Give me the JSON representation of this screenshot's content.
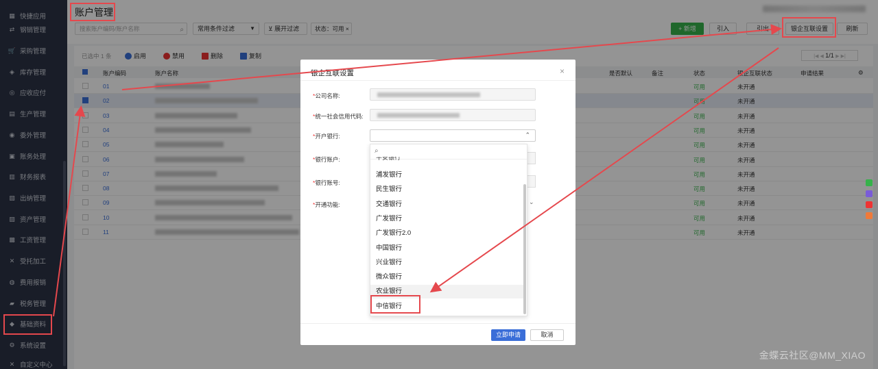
{
  "sidebar": {
    "items": [
      {
        "label": "快捷应用",
        "icon": "grid-icon"
      },
      {
        "label": "钢销管理",
        "icon": "swap-icon"
      },
      {
        "label": "采购管理",
        "icon": "cart-icon"
      },
      {
        "label": "库存管理",
        "icon": "box-icon"
      },
      {
        "label": "应收应付",
        "icon": "coin-icon"
      },
      {
        "label": "生产管理",
        "icon": "factory-icon"
      },
      {
        "label": "委外管理",
        "icon": "outsource-icon"
      },
      {
        "label": "账务处理",
        "icon": "ledger-icon"
      },
      {
        "label": "财务报表",
        "icon": "report-icon"
      },
      {
        "label": "出纳管理",
        "icon": "cashier-icon"
      },
      {
        "label": "资产管理",
        "icon": "asset-icon"
      },
      {
        "label": "工资管理",
        "icon": "salary-icon"
      },
      {
        "label": "受托加工",
        "icon": "tools-icon"
      },
      {
        "label": "费用报销",
        "icon": "expense-icon"
      },
      {
        "label": "税务管理",
        "icon": "tax-icon"
      },
      {
        "label": "基础资料",
        "icon": "layers-icon"
      },
      {
        "label": "系统设置",
        "icon": "gear-icon"
      },
      {
        "label": "自定义中心",
        "icon": "custom-icon"
      }
    ]
  },
  "header": {
    "title": "账户管理",
    "search_placeholder": "搜索账户编码/账户名称",
    "filter_select": "常用条件过滤",
    "expand_filter": "展开过滤",
    "status_tag": "状态：可用",
    "buttons": {
      "new": "+ 新增",
      "import": "引入",
      "export": "引出",
      "bank_link": "银企互联设置",
      "refresh": "刷新"
    }
  },
  "actions": {
    "selected_count": "已选中 1 条",
    "enable": "启用",
    "disable": "禁用",
    "delete": "删除",
    "copy": "复制",
    "pager": "1/1",
    "pager_prev": "|◀ ◀",
    "pager_next": "▶ ▶|"
  },
  "table": {
    "columns": [
      "账户编码",
      "账户名称",
      "是否默认",
      "备注",
      "状态",
      "银企互联状态",
      "申请结果"
    ],
    "rows": [
      {
        "code": "01",
        "status": "可用",
        "bank_status": "未开通",
        "selected": false
      },
      {
        "code": "02",
        "status": "可用",
        "bank_status": "未开通",
        "selected": true
      },
      {
        "code": "03",
        "status": "可用",
        "bank_status": "未开通",
        "selected": false
      },
      {
        "code": "04",
        "status": "可用",
        "bank_status": "未开通",
        "selected": false
      },
      {
        "code": "05",
        "status": "可用",
        "bank_status": "未开通",
        "selected": false
      },
      {
        "code": "06",
        "status": "可用",
        "bank_status": "未开通",
        "selected": false
      },
      {
        "code": "07",
        "status": "可用",
        "bank_status": "未开通",
        "selected": false
      },
      {
        "code": "08",
        "status": "可用",
        "bank_status": "未开通",
        "selected": false
      },
      {
        "code": "09",
        "status": "可用",
        "bank_status": "未开通",
        "selected": false
      },
      {
        "code": "10",
        "status": "可用",
        "bank_status": "未开通",
        "selected": false
      },
      {
        "code": "11",
        "status": "可用",
        "bank_status": "未开通",
        "selected": false
      }
    ]
  },
  "dialog": {
    "title": "银企互联设置",
    "fields": {
      "company": "公司名称:",
      "credit_code": "统一社会信用代码:",
      "bank": "开户银行:",
      "account": "银行账户:",
      "account_no": "银行账号:",
      "function": "开通功能:"
    },
    "apply": "立即申请",
    "cancel": "取消"
  },
  "dropdown": {
    "partial": "平安银行",
    "options": [
      "浦发银行",
      "民生银行",
      "交通银行",
      "广发银行",
      "广发银行2.0",
      "中国银行",
      "兴业银行",
      "微众银行",
      "农业银行",
      "中信银行"
    ],
    "highlighted": "农业银行"
  },
  "watermark": "金蝶云社区@MM_XIAO",
  "colors": {
    "sidebar_bg": "#2b3245",
    "primary": "#3a6ed8",
    "success": "#36b24a",
    "annotation": "#e5484d"
  }
}
